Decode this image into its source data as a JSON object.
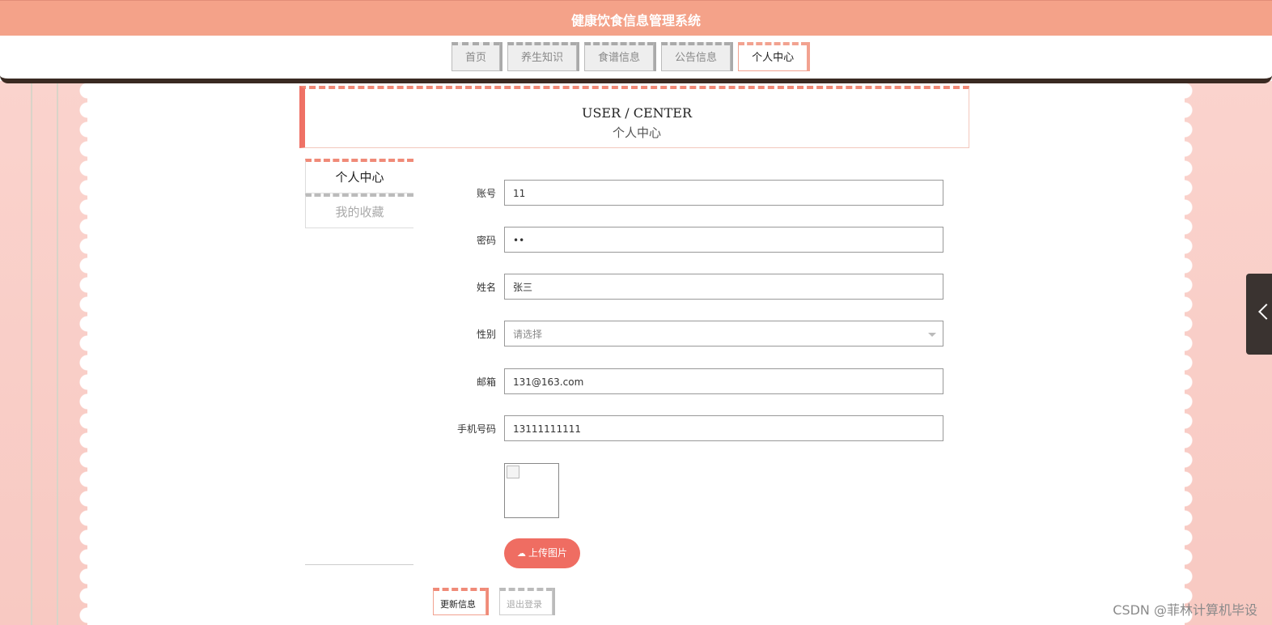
{
  "header": {
    "title": "健康饮食信息管理系统"
  },
  "nav": {
    "items": [
      {
        "label": "首页",
        "active": false
      },
      {
        "label": "养生知识",
        "active": false
      },
      {
        "label": "食谱信息",
        "active": false
      },
      {
        "label": "公告信息",
        "active": false
      },
      {
        "label": "个人中心",
        "active": true
      }
    ]
  },
  "section": {
    "title_en": "USER / CENTER",
    "title_zh": "个人中心"
  },
  "sidebar": {
    "items": [
      {
        "label": "个人中心",
        "active": true
      },
      {
        "label": "我的收藏",
        "active": false
      }
    ]
  },
  "form": {
    "account": {
      "label": "账号",
      "value": "11"
    },
    "password": {
      "label": "密码",
      "value": "••"
    },
    "name": {
      "label": "姓名",
      "value": "张三"
    },
    "gender": {
      "label": "性别",
      "placeholder": "请选择"
    },
    "email": {
      "label": "邮箱",
      "value": "131@163.com"
    },
    "phone": {
      "label": "手机号码",
      "value": "13111111111"
    },
    "upload_label": "上传图片",
    "upload_icon": "cloud-upload-icon"
  },
  "actions": {
    "update_label": "更新信息",
    "logout_label": "退出登录"
  },
  "watermark": "CSDN @菲林计算机毕设",
  "colors": {
    "header": "#f4a289",
    "accent": "#ef6d62",
    "tab_active_border": "#f2a290"
  }
}
